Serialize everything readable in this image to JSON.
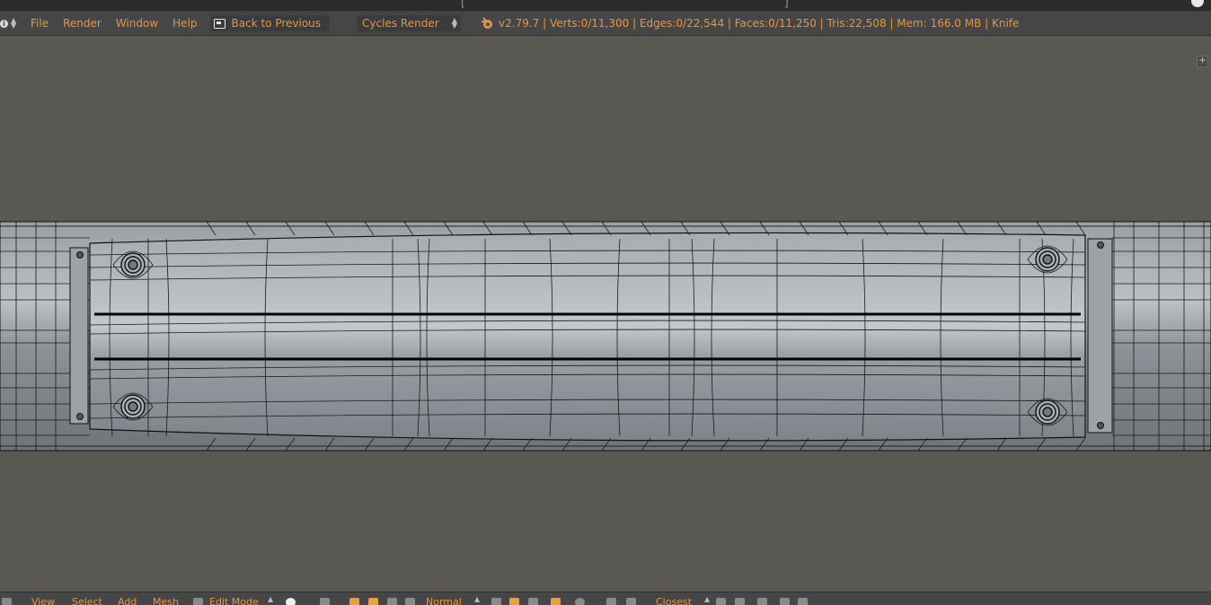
{
  "menus": [
    "File",
    "Render",
    "Window",
    "Help"
  ],
  "back_button": "Back to Previous",
  "render_engine": "Cycles Render",
  "stats": "v2.79.7 | Verts:0/11,300 | Edges:0/22,544 | Faces:0/11,250 | Tris:22,508 | Mem: 166.0 MB | Knife",
  "bottom": {
    "view": "View",
    "select": "Select",
    "add": "Add",
    "mesh": "Mesh",
    "mode": "Edit Mode",
    "orientation": "Normal",
    "snap": "Closest"
  },
  "icons": {
    "info_editor": "info-icon",
    "back": "screen-back-icon",
    "logo": "blender-logo-icon",
    "add_region": "plus-icon"
  },
  "colors": {
    "header_text": "#e7963a",
    "viewport_bg": "#595853",
    "header_bg": "#464646"
  }
}
